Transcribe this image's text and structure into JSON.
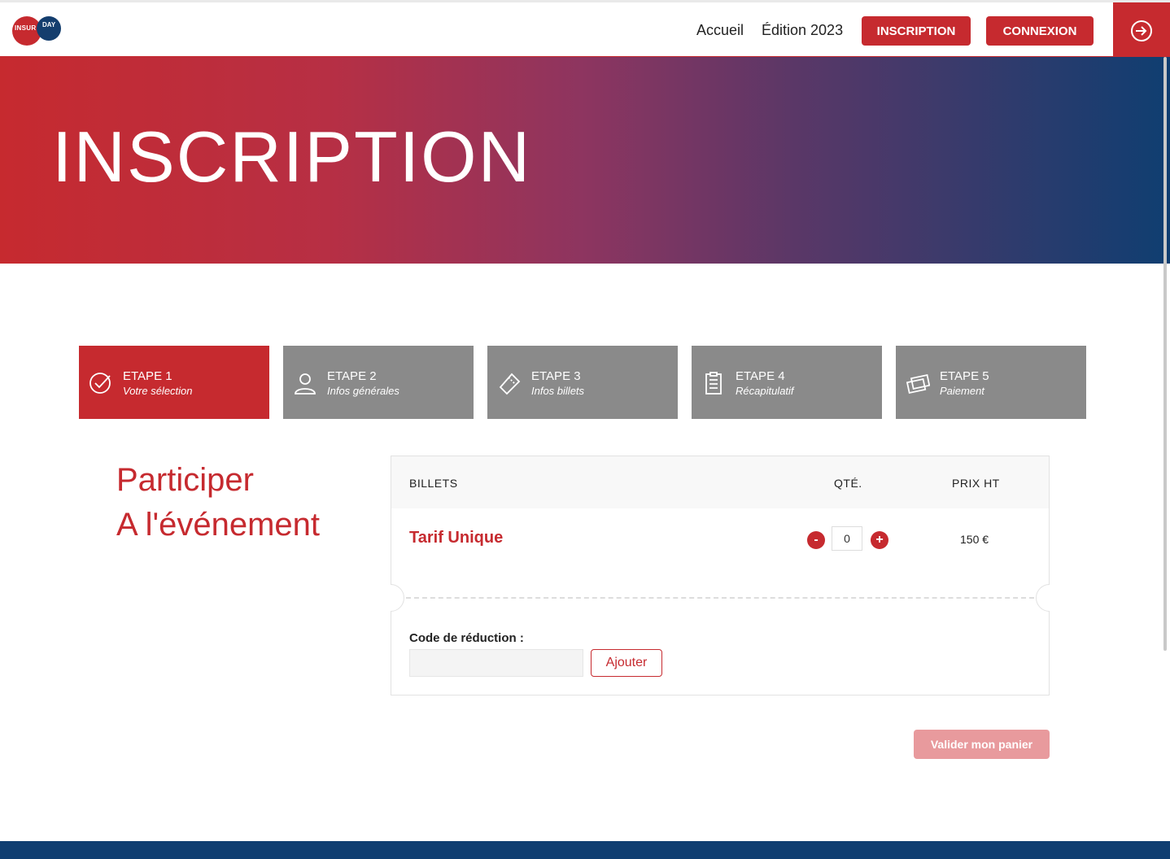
{
  "header": {
    "logo_text_1": "INSUR",
    "logo_text_2": "DAY",
    "nav_home": "Accueil",
    "nav_edition": "Édition 2023",
    "btn_inscription": "INSCRIPTION",
    "btn_connexion": "CONNEXION",
    "login_icon": "sign-in-icon",
    "accent_color": "#c62a2f",
    "dark_color": "#0f3e71"
  },
  "hero": {
    "title": "INSCRIPTION"
  },
  "steps": [
    {
      "label": "ETAPE 1",
      "sub": "Votre sélection",
      "icon": "check-circle-icon",
      "active": true
    },
    {
      "label": "ETAPE 2",
      "sub": "Infos générales",
      "icon": "user-icon",
      "active": false
    },
    {
      "label": "ETAPE 3",
      "sub": "Infos billets",
      "icon": "ticket-icon",
      "active": false
    },
    {
      "label": "ETAPE 4",
      "sub": "Récapitulatif",
      "icon": "clipboard-icon",
      "active": false
    },
    {
      "label": "ETAPE 5",
      "sub": "Paiement",
      "icon": "credit-card-icon",
      "active": false
    }
  ],
  "intro": {
    "line1": "Participer",
    "line2": "A l'événement"
  },
  "cart": {
    "col_tickets": "BILLETS",
    "col_qty": "QTÉ.",
    "col_price": "PRIX HT",
    "items": [
      {
        "name": "Tarif Unique",
        "qty": "0",
        "price": "150 €",
        "minus": "-",
        "plus": "+"
      }
    ],
    "code_label": "Code de réduction :",
    "code_value": "",
    "add_label": "Ajouter"
  },
  "validate_label": "Valider mon panier"
}
